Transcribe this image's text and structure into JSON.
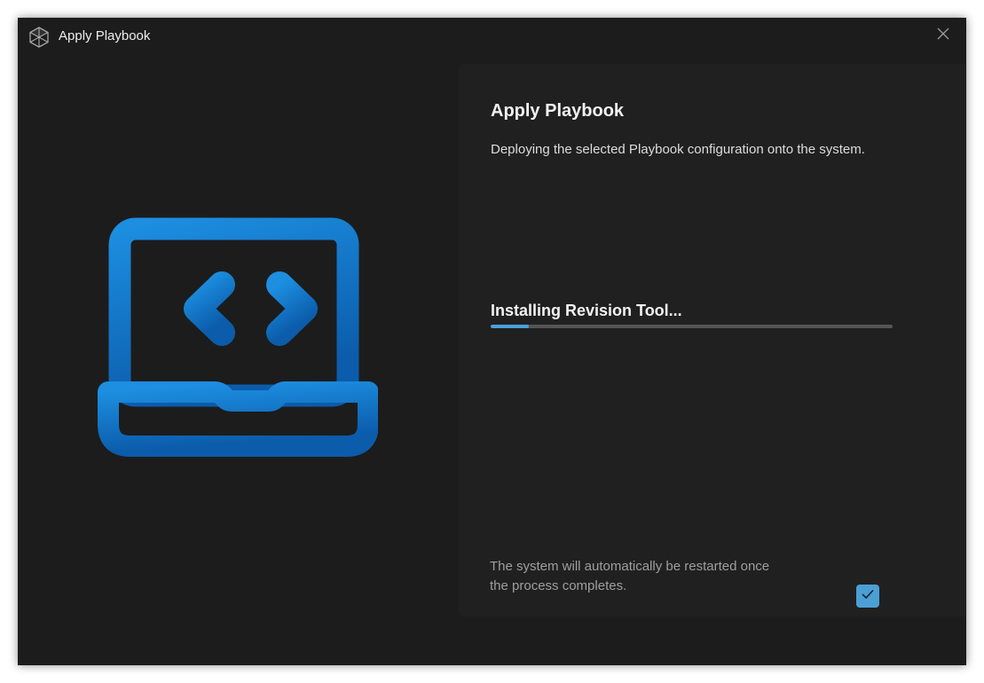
{
  "window": {
    "title": "Apply Playbook",
    "icon": "playbook-cube-icon",
    "close_icon": "close-icon"
  },
  "hero": {
    "icon": "laptop-code-icon",
    "color": "#1a7fd0"
  },
  "panel": {
    "title": "Apply Playbook",
    "description": "Deploying the selected Playbook configuration onto the system.",
    "status": "Installing Revision Tool...",
    "progress_fraction": 0.095,
    "restart_note": "The system will automatically be restarted once the process completes.",
    "restart_checked": true
  },
  "colors": {
    "window_bg": "#1c1c1c",
    "panel_bg": "#202020",
    "accent": "#4b9fd5",
    "progress_track": "#555555"
  }
}
